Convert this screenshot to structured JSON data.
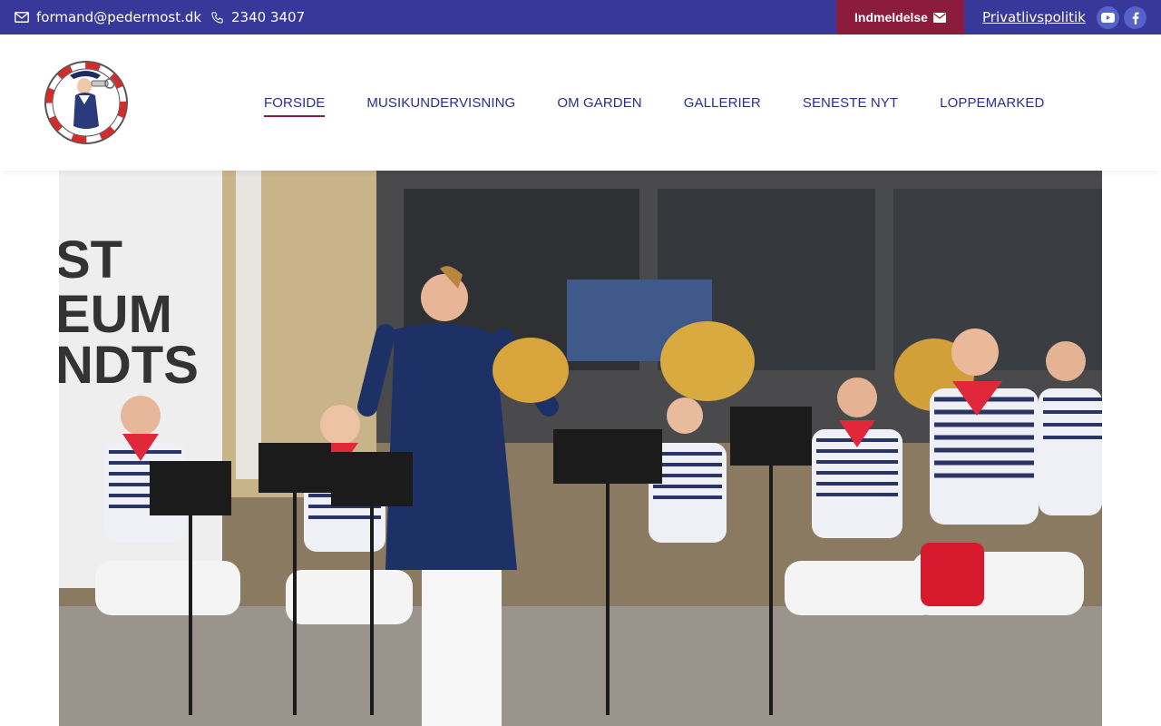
{
  "topbar": {
    "email": "formand@pedermost.dk",
    "phone": "2340 3407",
    "join_label": "Indmeldelse",
    "privacy_label": "Privatlivspolitik",
    "social": [
      "youtube-icon",
      "facebook-icon"
    ]
  },
  "nav": {
    "items": [
      {
        "label": "FORSIDE",
        "active": true
      },
      {
        "label": "MUSIKUNDERVISNING",
        "active": false
      },
      {
        "label": "OM GARDEN",
        "active": false
      },
      {
        "label": "GALLERIER",
        "active": false
      },
      {
        "label": "SENESTE NYT",
        "active": false
      },
      {
        "label": "LOPPEMARKED",
        "active": false
      }
    ]
  },
  "hero": {
    "banner_lines": [
      "ST",
      "EUM",
      "NDTS"
    ]
  },
  "colors": {
    "topbar": "#37389a",
    "join_button": "#8b1c3d",
    "nav_text": "#2b2f8c",
    "nav_underline": "#8b1c3d",
    "social_bg": "#5562c9"
  }
}
